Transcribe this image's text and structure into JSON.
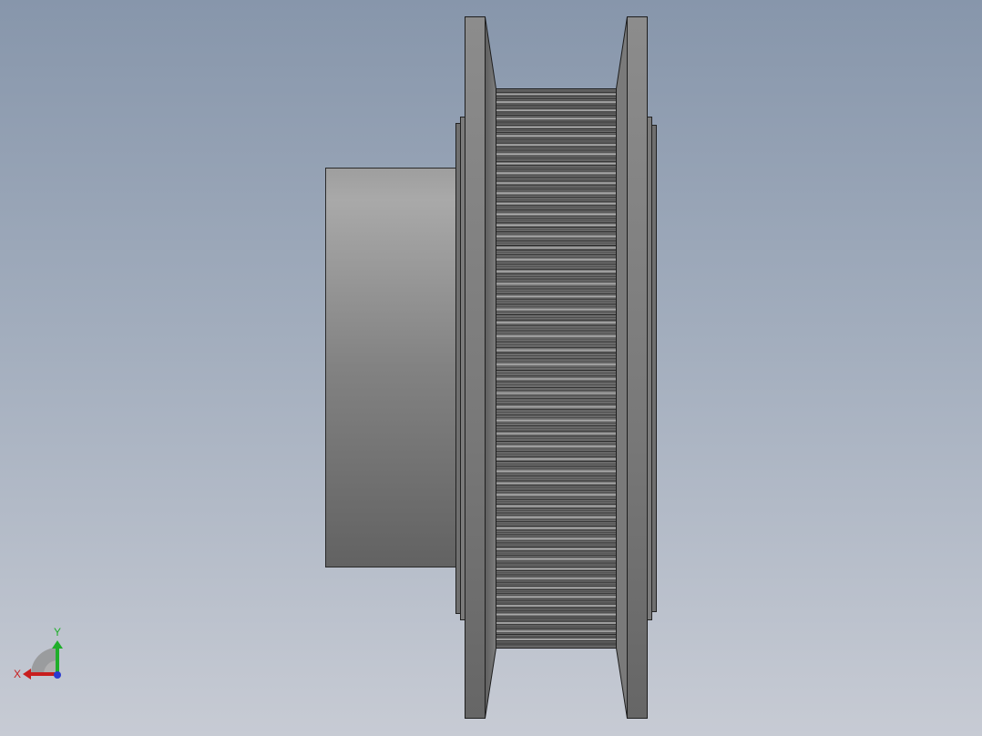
{
  "viewport": {
    "background_top": "#8796ab",
    "background_bottom": "#c7cbd4"
  },
  "model": {
    "part": "timing-pulley",
    "view": "side",
    "colors": {
      "hub_light": "#a6a6a6",
      "hub_dark": "#646464",
      "flange": "#7a7a7a",
      "teeth_base": "#6c6c6c",
      "edge": "#222222"
    }
  },
  "triad": {
    "x_label": "X",
    "y_label": "Y",
    "x_color": "#c81e1e",
    "y_color": "#1fae2a",
    "z_color": "#2a3ad0"
  }
}
